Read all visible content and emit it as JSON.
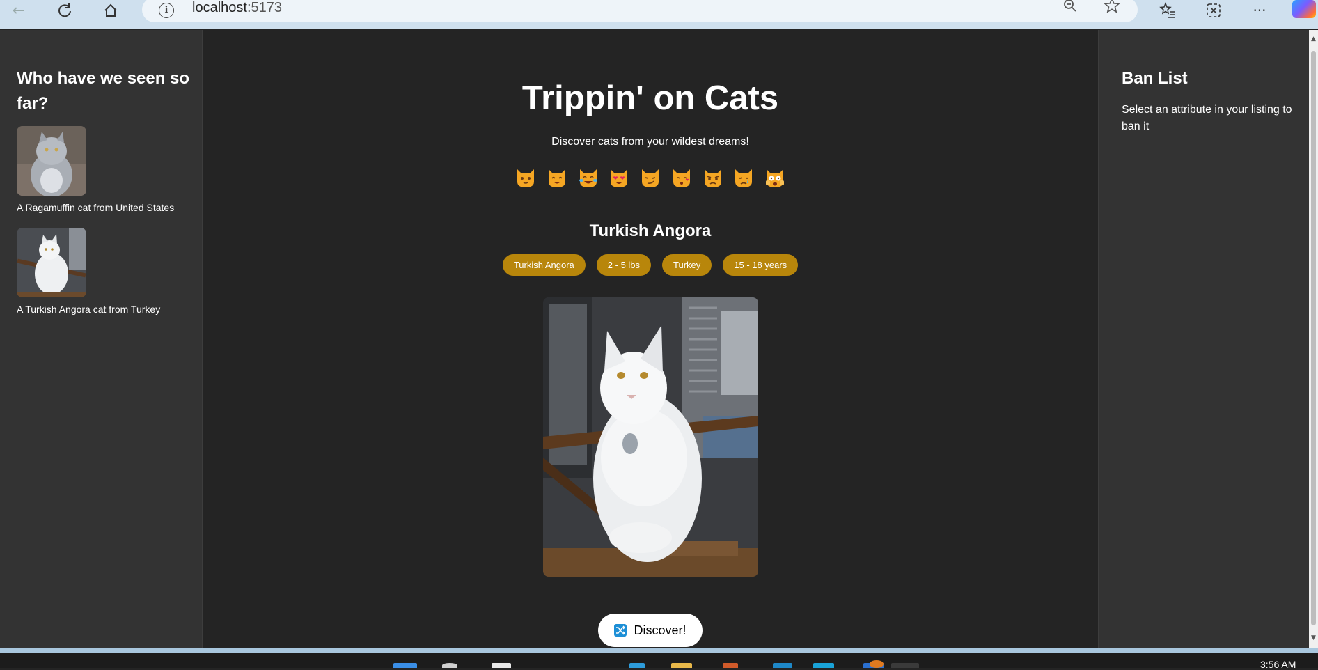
{
  "browser": {
    "url_host": "localhost",
    "url_port": ":5173"
  },
  "left_panel": {
    "heading": "Who have we seen so far?",
    "items": [
      {
        "caption": "A Ragamuffin cat from United States"
      },
      {
        "caption": "A Turkish Angora cat from Turkey"
      }
    ]
  },
  "main": {
    "title": "Trippin' on Cats",
    "subtitle": "Discover cats from your wildest dreams!",
    "emojis": [
      "cat-face",
      "grinning-cat",
      "cat-tears-of-joy",
      "heart-eyes-cat",
      "smirking-cat",
      "kissing-cat",
      "pouting-cat",
      "crying-cat",
      "weary-cat"
    ],
    "cat_name": "Turkish Angora",
    "attributes": [
      "Turkish Angora",
      "2 - 5 lbs",
      "Turkey",
      "15 - 18 years"
    ],
    "discover_label": "Discover!"
  },
  "right_panel": {
    "heading": "Ban List",
    "description": "Select an attribute in your listing to ban it"
  },
  "colors": {
    "background": "#242424",
    "panel": "#333333",
    "chip": "#b8860b",
    "accent_icon": "#1d8fd6"
  },
  "taskbar": {
    "clock": "3:56 AM"
  }
}
